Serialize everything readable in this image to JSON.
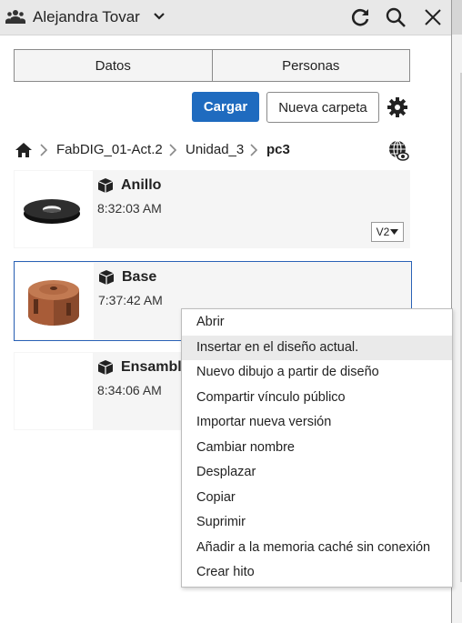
{
  "header": {
    "user_name": "Alejandra Tovar",
    "icons": [
      "team-icon",
      "chevron-down-icon",
      "refresh-icon",
      "search-icon",
      "close-icon"
    ]
  },
  "tabs": [
    {
      "label": "Datos"
    },
    {
      "label": "Personas"
    }
  ],
  "toolbar": {
    "upload_label": "Cargar",
    "new_folder_label": "Nueva carpeta",
    "accent_color": "#1f6bbf"
  },
  "breadcrumb": {
    "items": [
      "FabDIG_01-Act.2",
      "Unidad_3",
      "pc3"
    ]
  },
  "items": [
    {
      "name": "Anillo",
      "time": "8:32:03 AM",
      "version": "V2"
    },
    {
      "name": "Base",
      "time": "7:37:42 AM"
    },
    {
      "name": "Ensamble",
      "time": "8:34:06 AM"
    }
  ],
  "context_menu": {
    "items": [
      "Abrir",
      "Insertar en el diseño actual.",
      "Nuevo dibujo a partir de diseño",
      "Compartir vínculo público",
      "Importar nueva versión",
      "Cambiar nombre",
      "Desplazar",
      "Copiar",
      "Suprimir",
      "Añadir a la memoria caché sin conexión",
      "Crear hito"
    ],
    "hovered_index": 1
  }
}
